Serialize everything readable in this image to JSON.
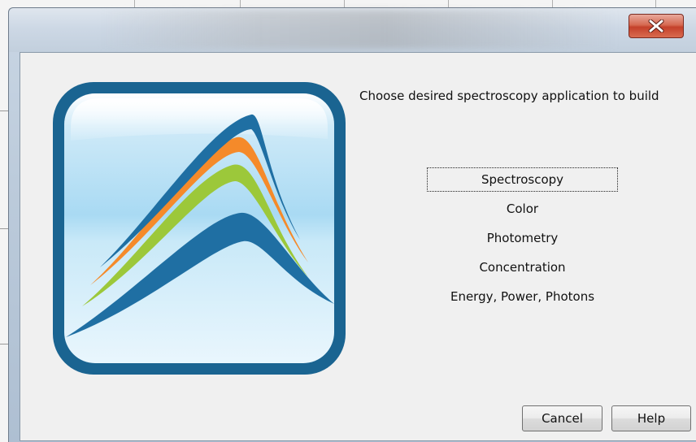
{
  "window": {
    "close_icon": "close-x-icon"
  },
  "logo": {
    "icon": "spectral-peaks-logo-icon",
    "colors": {
      "frame": "#1a6491",
      "sky": "#bfe3f6",
      "blue": "#1f6fa3",
      "orange": "#f58a2a",
      "green": "#9cc83a"
    }
  },
  "dialog": {
    "prompt": "Choose desired spectroscopy application to build",
    "options": [
      {
        "label": "Spectroscopy",
        "focused": true
      },
      {
        "label": "Color"
      },
      {
        "label": "Photometry"
      },
      {
        "label": "Concentration"
      },
      {
        "label": "Energy, Power, Photons"
      }
    ],
    "buttons": {
      "cancel": "Cancel",
      "help": "Help"
    }
  }
}
